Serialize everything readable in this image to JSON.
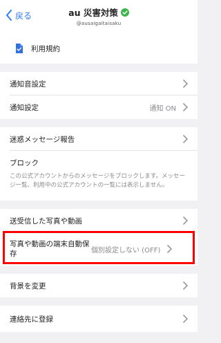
{
  "header": {
    "back_label": "戻る",
    "title": "au 災害対策",
    "account_id": "@ausaigaitaisaku"
  },
  "terms": {
    "label": "利用規約"
  },
  "notifications": {
    "sound_label": "通知音設定",
    "settings_label": "通知設定",
    "settings_value": "通知 ON"
  },
  "spam": {
    "report_label": "迷惑メッセージ報告"
  },
  "block": {
    "title": "ブロック",
    "description": "この公式アカウントからのメッセージをブロックします。メッセージ一覧、利用中の公式アカウントの一覧には表示しません。"
  },
  "media": {
    "sent_received_label": "送受信した写真や動画",
    "autosave_label": "写真や動画の端末自動保存",
    "autosave_value": "個別設定しない (OFF)"
  },
  "background": {
    "label": "背景を変更"
  },
  "contacts": {
    "label": "連絡先に登録"
  },
  "colors": {
    "accent": "#2f7cf6",
    "verified": "#3bb54a",
    "highlight": "#ff0000",
    "background": "#f1f1f3"
  }
}
